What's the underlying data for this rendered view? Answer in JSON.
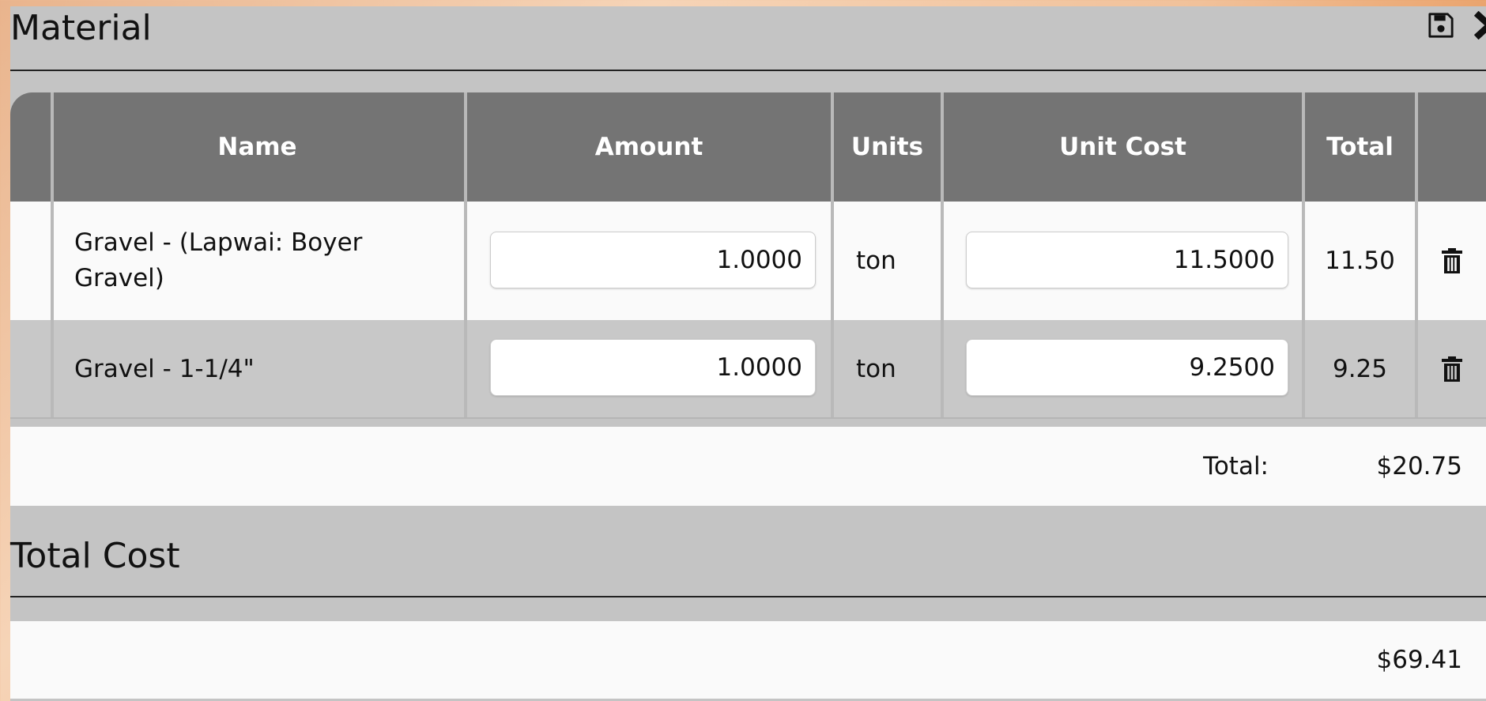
{
  "material": {
    "title": "Material",
    "icons": {
      "save": "save-icon",
      "next": "chevron-right-icon"
    },
    "columns": [
      "Name",
      "Amount",
      "Units",
      "Unit Cost",
      "Total"
    ],
    "rows": [
      {
        "name": "Gravel - (Lapwai: Boyer Gravel)",
        "amount": "1.0000",
        "units": "ton",
        "unit_cost": "11.5000",
        "total": "11.50"
      },
      {
        "name": "Gravel - 1-1/4\"",
        "amount": "1.0000",
        "units": "ton",
        "unit_cost": "9.2500",
        "total": "9.25"
      }
    ],
    "total_label": "Total:",
    "total_value": "$20.75"
  },
  "total_cost": {
    "title": "Total Cost",
    "value": "$69.41"
  },
  "colors": {
    "header_bg": "#747474",
    "panel_bg": "#c4c4c4",
    "row_light": "#fafafa"
  }
}
